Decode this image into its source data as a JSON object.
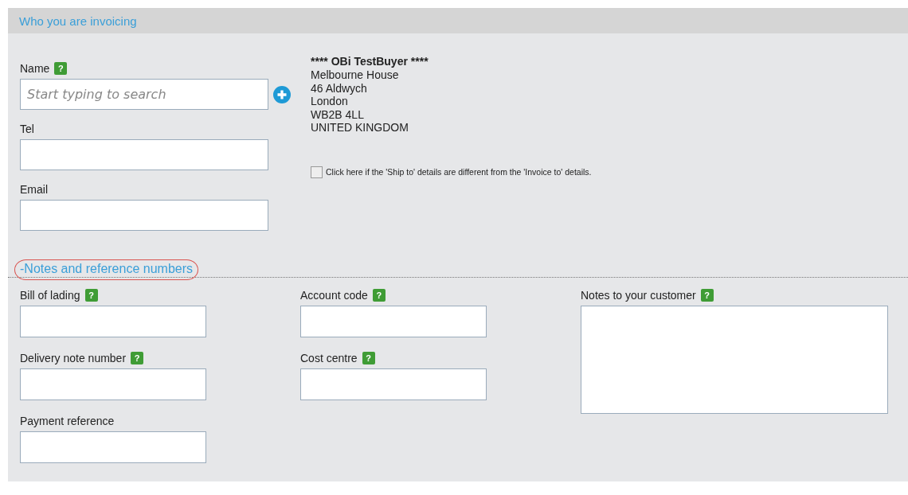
{
  "panel_title": "Who you are invoicing",
  "contact_fields": [
    {
      "label": "Name",
      "help_icon": "?",
      "placeholder": "Start typing to search",
      "add_button": true
    },
    {
      "label": "Tel"
    },
    {
      "label": "Email"
    }
  ],
  "address": {
    "name": "**** OBi TestBuyer ****",
    "lines": [
      "Melbourne House",
      "46 Aldwych",
      "London",
      "WB2B 4LL",
      "UNITED KINGDOM"
    ]
  },
  "ship_to_checkbox": {
    "label": "Click here if the 'Ship to' details are different from the 'Invoice to' details.",
    "checked": false
  },
  "notes_section": {
    "title": "-Notes and reference numbers",
    "circled": true
  },
  "reference_columns": [
    [
      {
        "label": "Bill of lading",
        "help_icon": "?"
      },
      {
        "label": "Delivery note number",
        "help_icon": "?"
      },
      {
        "label": "Payment reference"
      }
    ],
    [
      {
        "label": "Account code",
        "help_icon": "?"
      },
      {
        "label": "Cost centre",
        "help_icon": "?"
      }
    ],
    [
      {
        "label": "Notes to your customer",
        "help_icon": "?",
        "kind": "textarea"
      }
    ]
  ]
}
